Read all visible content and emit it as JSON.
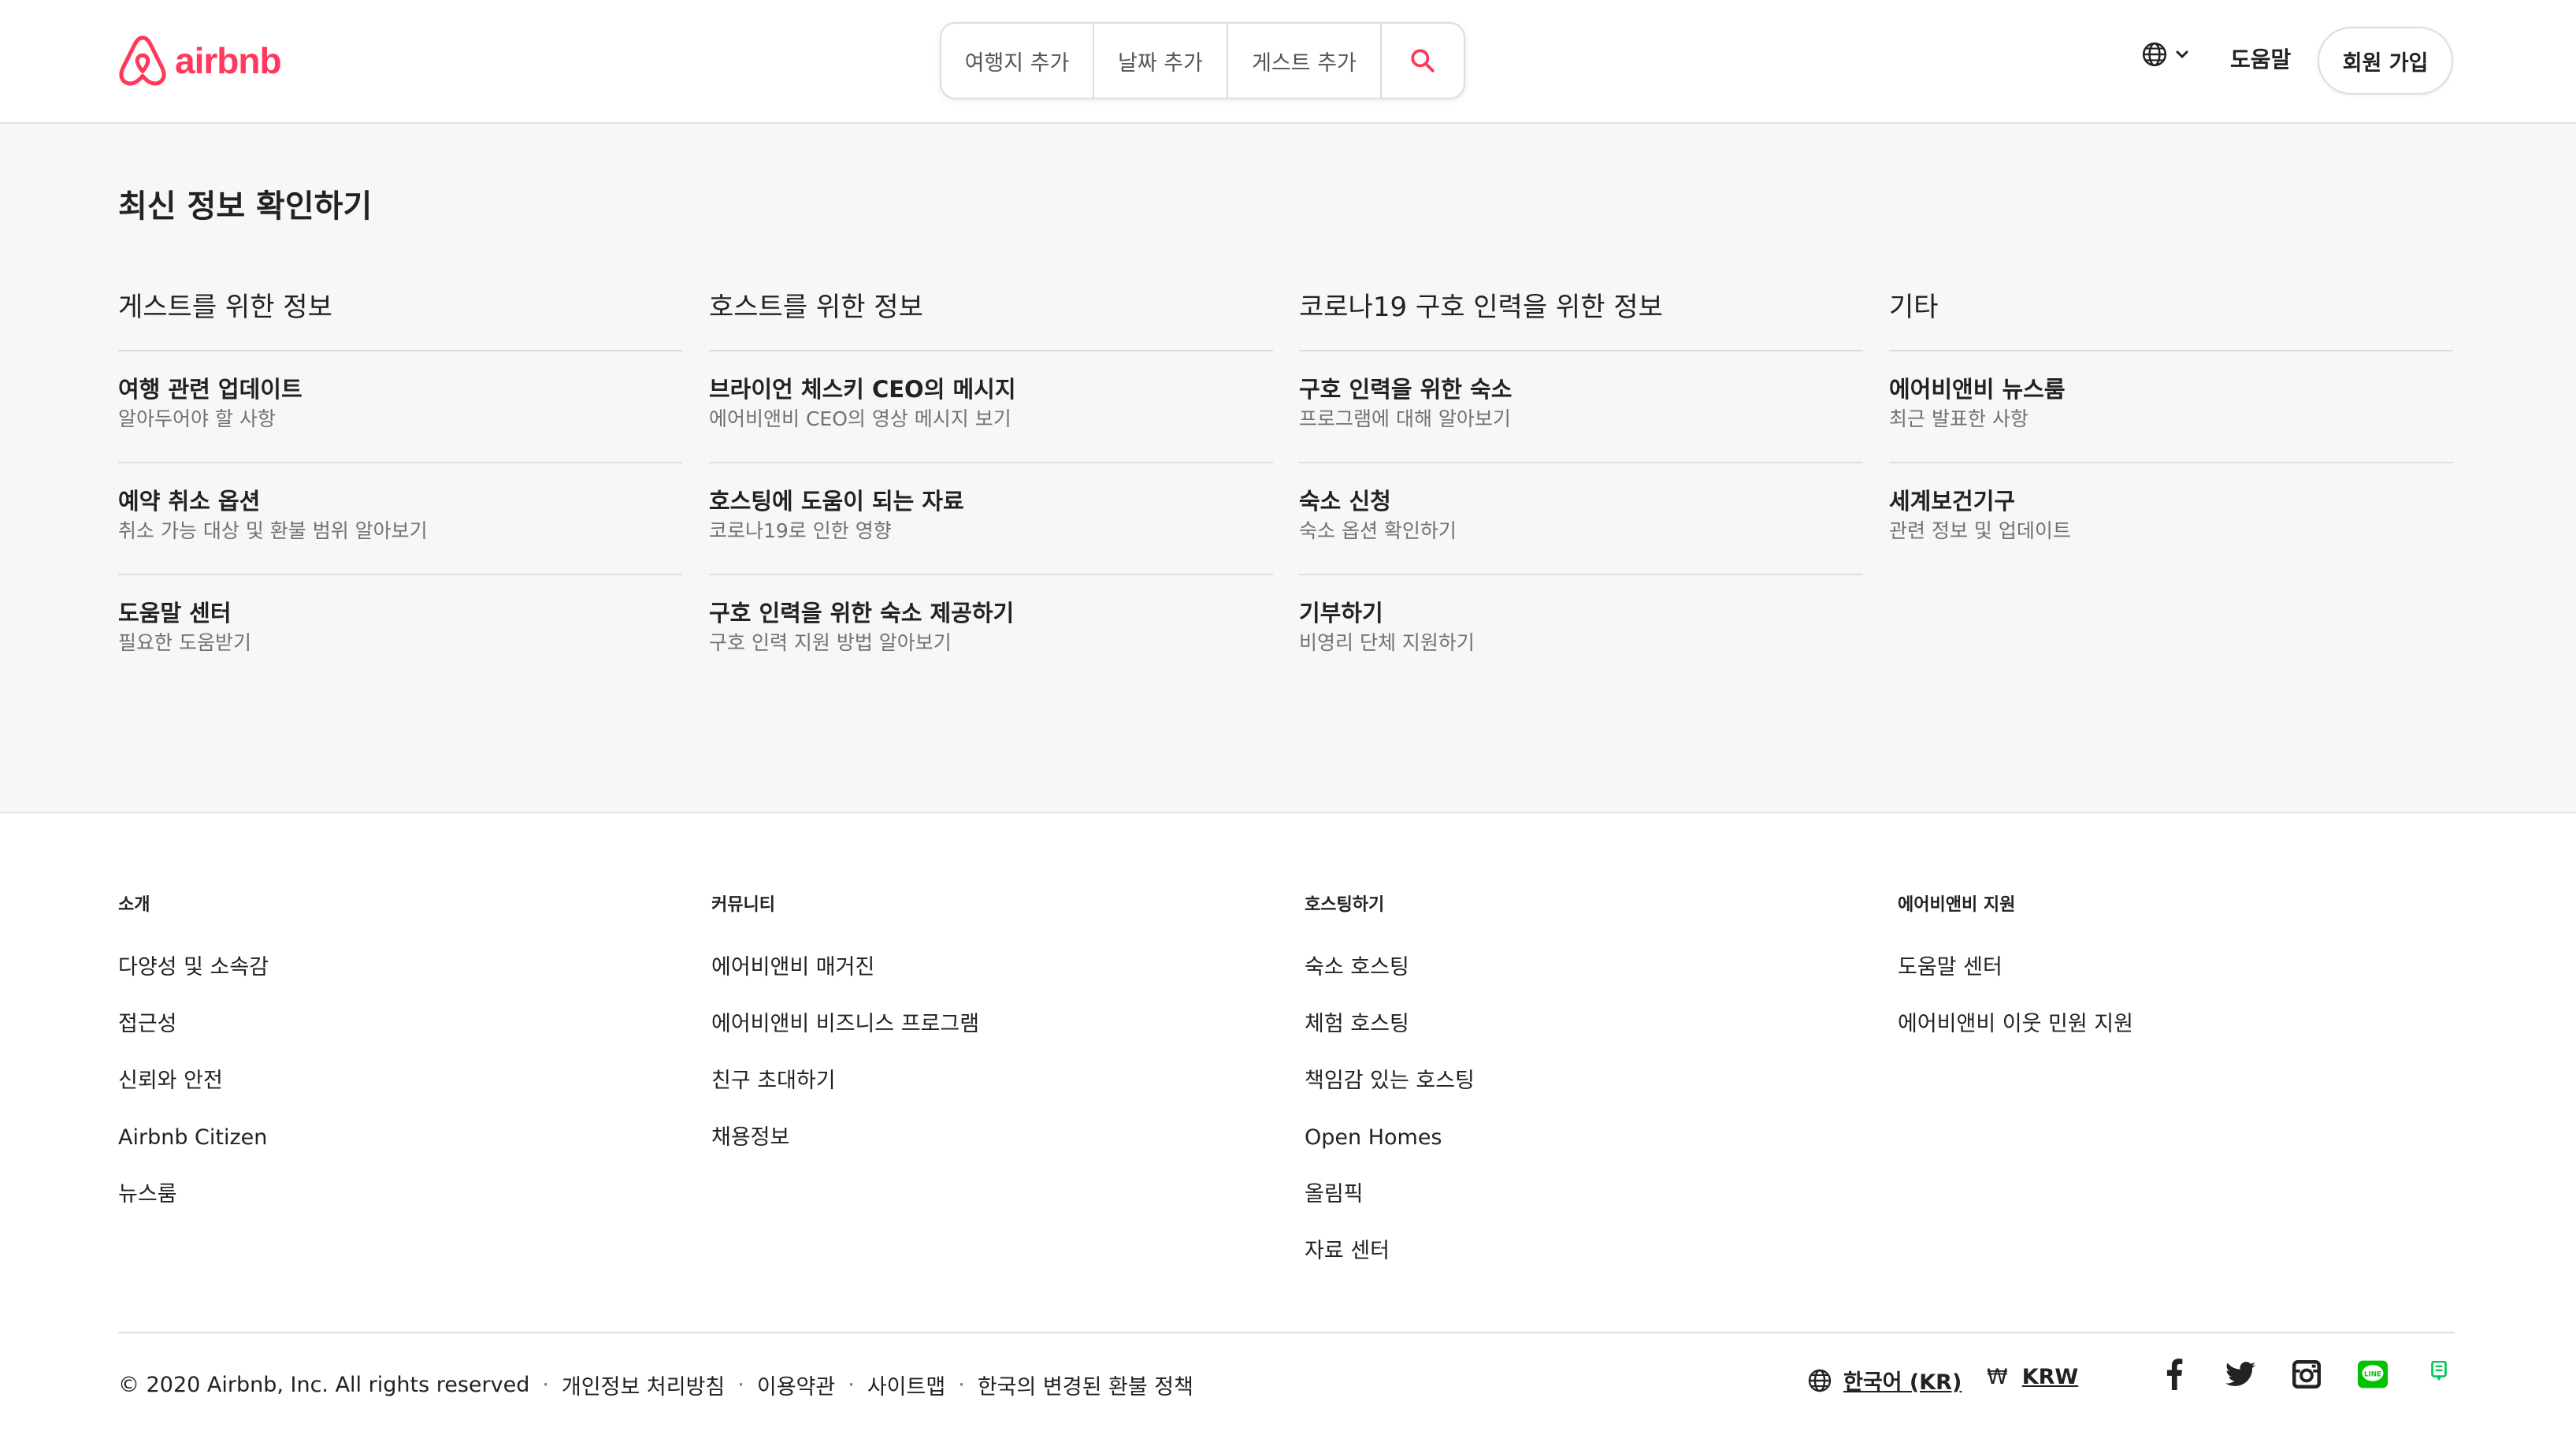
{
  "header": {
    "logo_text": "airbnb",
    "search": {
      "destination": "여행지 추가",
      "dates": "날짜 추가",
      "guests": "게스트 추가"
    },
    "help": "도움말",
    "signup": "회원 가입"
  },
  "updates": {
    "title": "최신 정보 확인하기",
    "columns": [
      {
        "title": "게스트를 위한 정보",
        "items": [
          {
            "title": "여행 관련 업데이트",
            "sub": "알아두어야 할 사항"
          },
          {
            "title": "예약 취소 옵션",
            "sub": "취소 가능 대상 및 환불 범위 알아보기"
          },
          {
            "title": "도움말 센터",
            "sub": "필요한 도움받기"
          }
        ]
      },
      {
        "title": "호스트를 위한 정보",
        "items": [
          {
            "title": "브라이언 체스키 CEO의 메시지",
            "sub": "에어비앤비 CEO의 영상 메시지 보기"
          },
          {
            "title": "호스팅에 도움이 되는 자료",
            "sub": "코로나19로 인한 영향"
          },
          {
            "title": "구호 인력을 위한 숙소 제공하기",
            "sub": "구호 인력 지원 방법 알아보기"
          }
        ]
      },
      {
        "title": "코로나19 구호 인력을 위한 정보",
        "items": [
          {
            "title": "구호 인력을 위한 숙소",
            "sub": "프로그램에 대해 알아보기"
          },
          {
            "title": "숙소 신청",
            "sub": "숙소 옵션 확인하기"
          },
          {
            "title": "기부하기",
            "sub": "비영리 단체 지원하기"
          }
        ]
      },
      {
        "title": "기타",
        "items": [
          {
            "title": "에어비앤비 뉴스룸",
            "sub": "최근 발표한 사항"
          },
          {
            "title": "세계보건기구",
            "sub": "관련 정보 및 업데이트"
          }
        ]
      }
    ]
  },
  "footer": {
    "columns": [
      {
        "title": "소개",
        "links": [
          "다양성 및 소속감",
          "접근성",
          "신뢰와 안전",
          "Airbnb Citizen",
          "뉴스룸"
        ]
      },
      {
        "title": "커뮤니티",
        "links": [
          "에어비앤비 매거진",
          "에어비앤비 비즈니스 프로그램",
          "친구 초대하기",
          "채용정보"
        ]
      },
      {
        "title": "호스팅하기",
        "links": [
          "숙소 호스팅",
          "체험 호스팅",
          "책임감 있는 호스팅",
          "Open Homes",
          "올림픽",
          "자료 센터"
        ]
      },
      {
        "title": "에어비앤비 지원",
        "links": [
          "도움말 센터",
          "에어비앤비 이웃 민원 지원"
        ]
      }
    ],
    "copyright": "© 2020 Airbnb, Inc. All rights reserved",
    "legal_links": [
      "개인정보 처리방침",
      "이용약관",
      "사이트맵",
      "한국의 변경된 환불 정책"
    ],
    "separator": "·",
    "language": "한국어 (KR)",
    "currency_symbol": "₩",
    "currency": "KRW",
    "social_icons": [
      "facebook-icon",
      "twitter-icon",
      "instagram-icon",
      "line-icon",
      "naver-blog-icon"
    ]
  },
  "colors": {
    "brand": "#FF385C",
    "line_green": "#00C300"
  }
}
